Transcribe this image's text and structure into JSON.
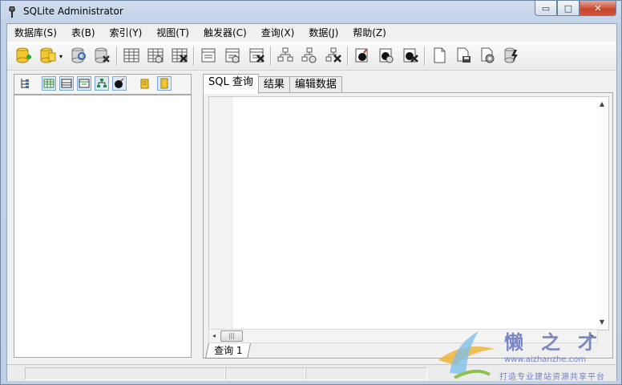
{
  "window": {
    "title": "SQLite Administrator",
    "buttons": {
      "minimize": "▭",
      "maximize": "□",
      "close": "✕"
    }
  },
  "menu": [
    {
      "label": "数据库(S)"
    },
    {
      "label": "表(B)"
    },
    {
      "label": "索引(Y)"
    },
    {
      "label": "视图(T)"
    },
    {
      "label": "触发器(C)"
    },
    {
      "label": "查询(X)"
    },
    {
      "label": "数据(J)"
    },
    {
      "label": "帮助(Z)"
    }
  ],
  "toolbar": {
    "icons": [
      "database-new-icon",
      "database-open-icon",
      "database-refresh-icon",
      "database-delete-icon",
      "table-icon",
      "table-edit-icon",
      "table-delete-icon",
      "index-icon",
      "index-edit-icon",
      "index-delete-icon",
      "view-icon",
      "view-edit-icon",
      "view-delete-icon",
      "trigger-icon",
      "trigger-edit-icon",
      "trigger-delete-icon",
      "document-icon",
      "save-icon",
      "settings-icon",
      "execute-icon"
    ],
    "dropdown_glyph": "▾"
  },
  "left_panel": {
    "icons": [
      "tree-icon",
      "table-grid-icon",
      "list-icon",
      "table-edit-icon",
      "hierarchy-icon",
      "bomb-icon",
      "sql-icon",
      "db-file-icon"
    ]
  },
  "tabs": [
    {
      "label": "SQL 查询",
      "active": true
    },
    {
      "label": "结果",
      "active": false
    },
    {
      "label": "编辑数据",
      "active": false
    }
  ],
  "editor": {
    "content": "",
    "scroll_up": "▲",
    "scroll_down": "▼",
    "scroll_left": "◂",
    "scroll_right": "▸",
    "thumb_grip": "|||"
  },
  "bottom_tab": {
    "label": "查询 1"
  },
  "watermark": {
    "title": "懒之才",
    "url": "www.aizhanzhe.com",
    "slogan": "打造专业建站资源共享平台"
  },
  "colors": {
    "accent": "#3a6fb0",
    "close_button": "#c7432a",
    "watermark": "#7a86c6"
  }
}
